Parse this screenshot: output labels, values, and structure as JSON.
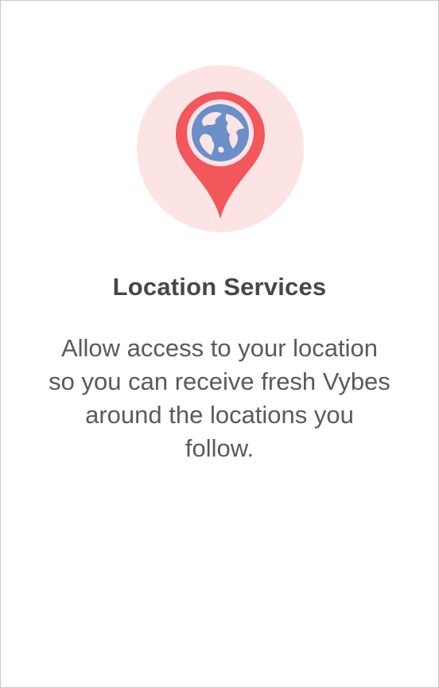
{
  "permission": {
    "icon": "location-pin-globe-icon",
    "title": "Location Services",
    "description": "Allow access to your location so you can receive fresh Vybes around the locations you follow."
  },
  "colors": {
    "circle_bg": "#fde4e4",
    "pin": "#f2575b",
    "globe": "#6b8fc9",
    "title_text": "#474747",
    "body_text": "#5a5a5a"
  }
}
